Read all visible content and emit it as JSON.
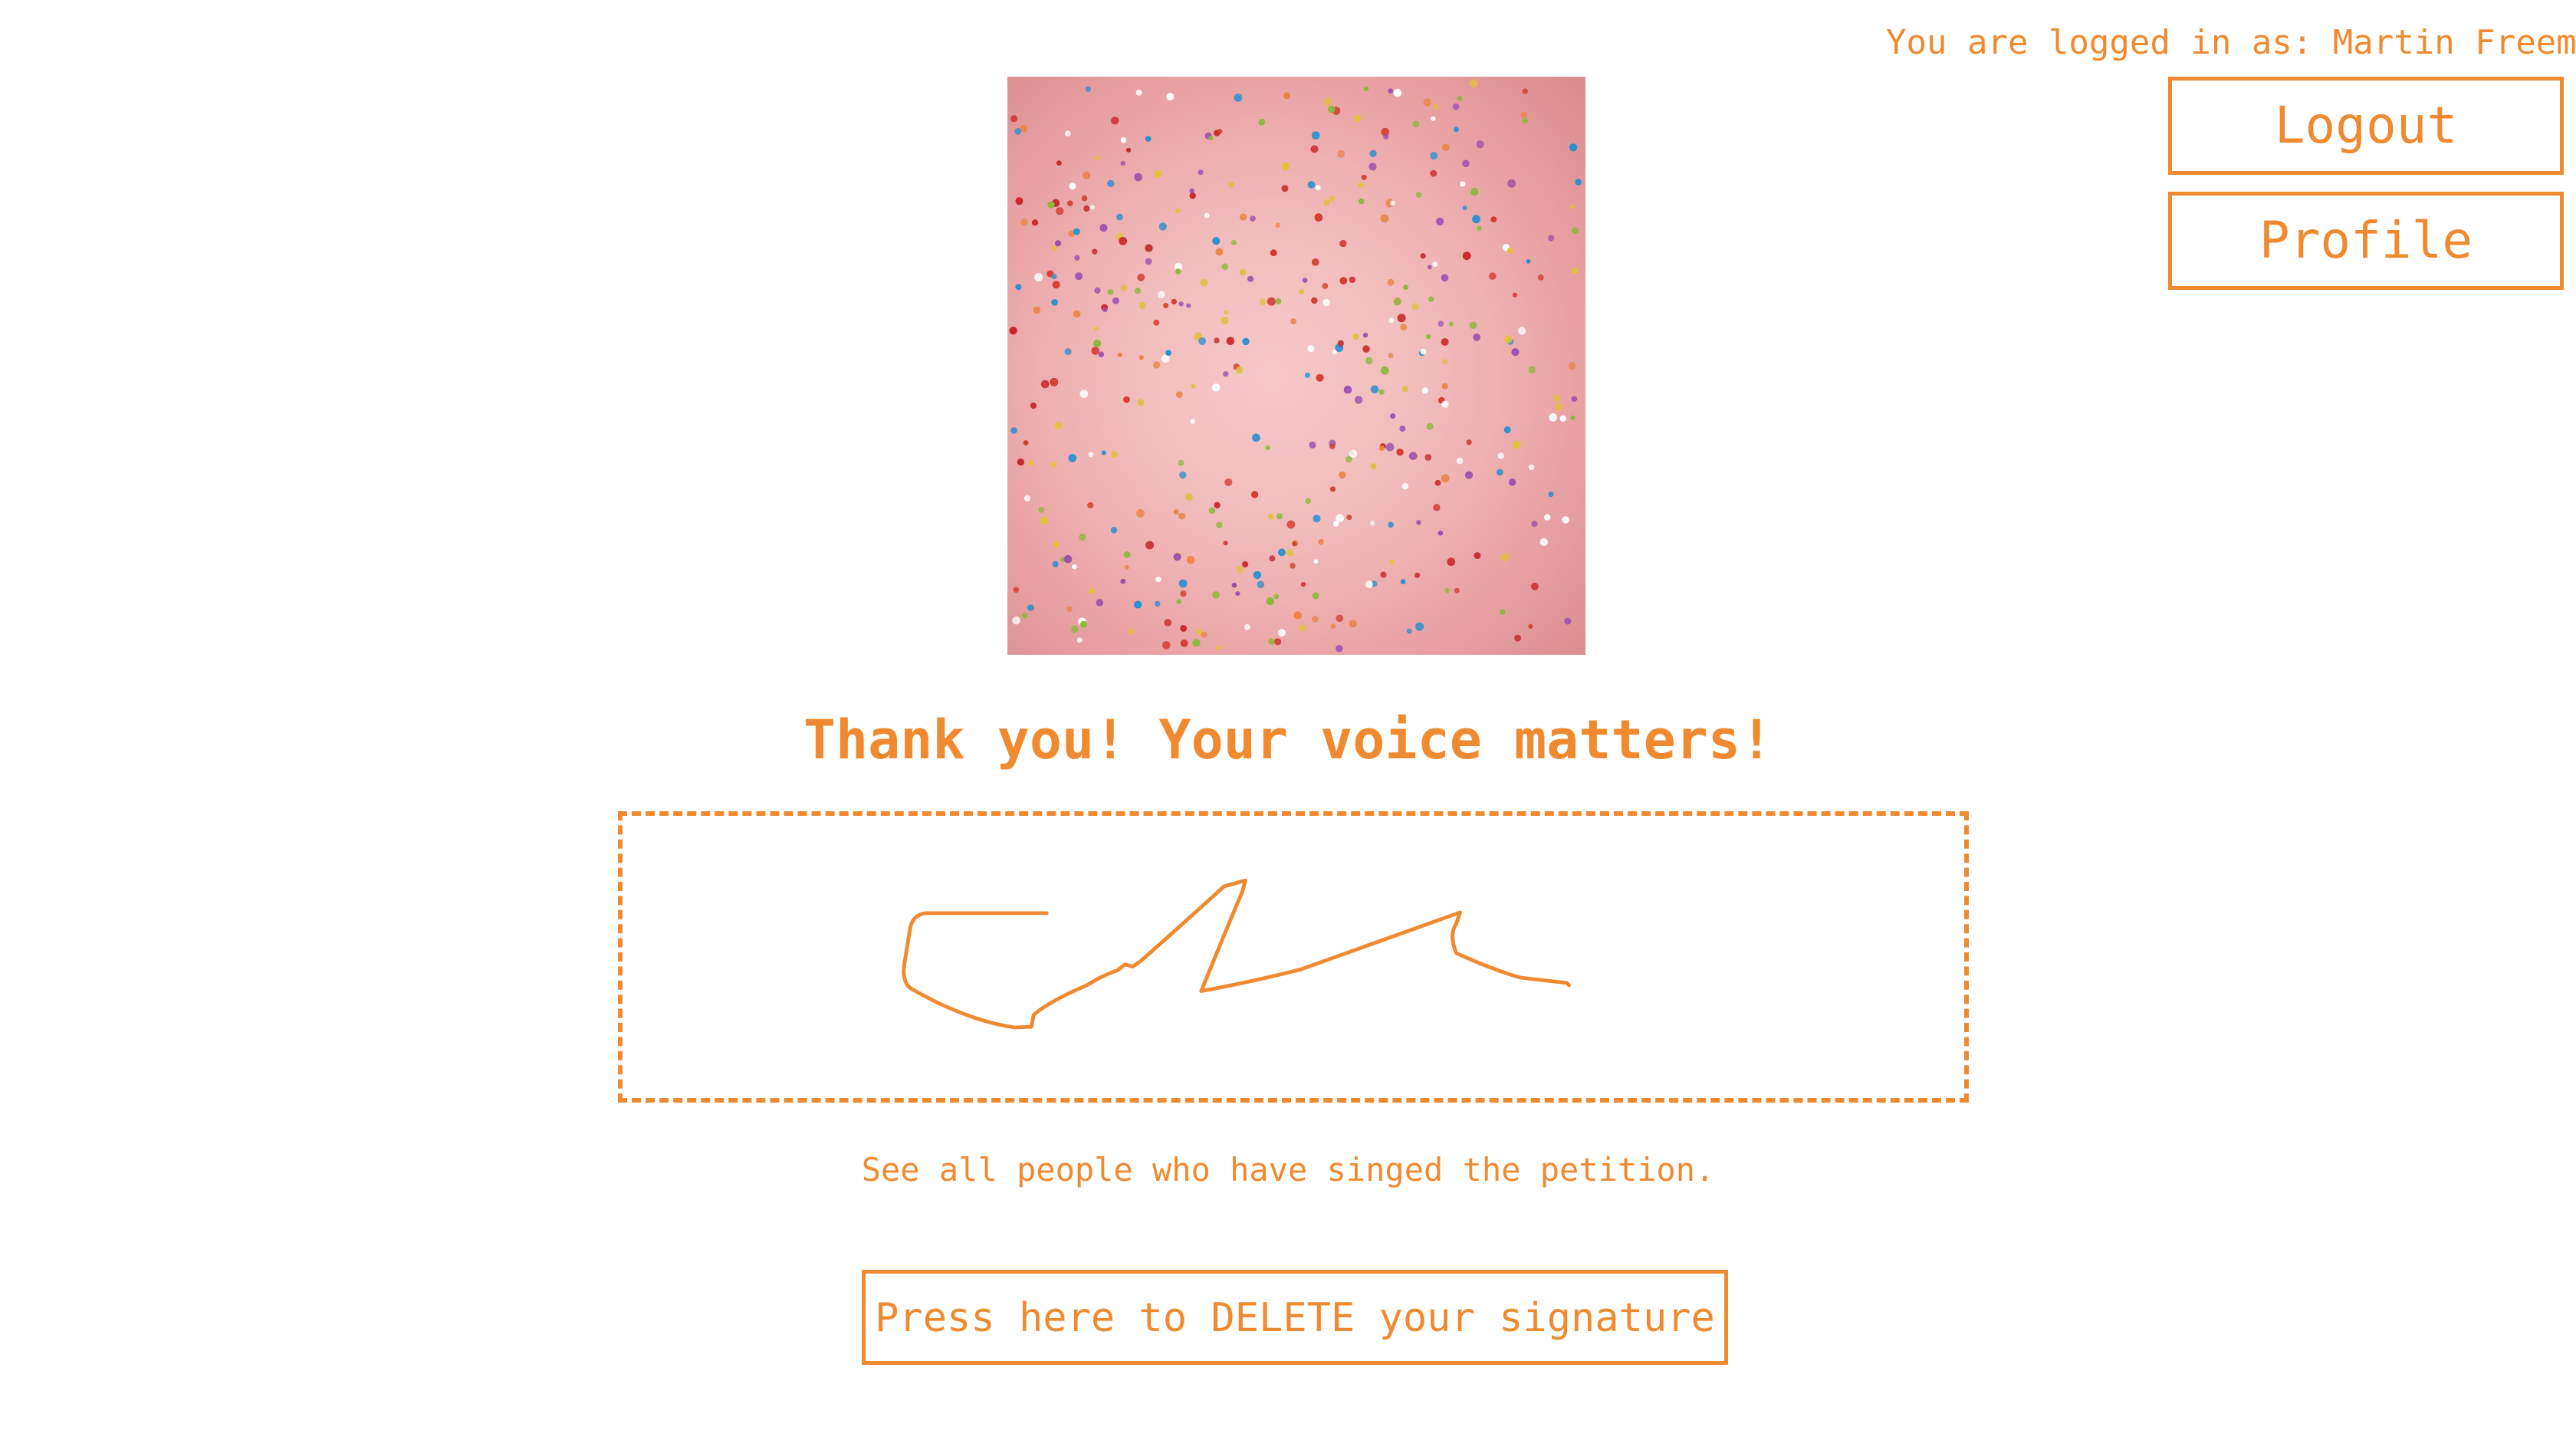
{
  "header": {
    "login_status": "You are logged in as: Martin Freeman",
    "logout_label": "Logout",
    "profile_label": "Profile"
  },
  "main": {
    "thank_you": "Thank you! Your voice matters!",
    "signers_link": "See all people who have singed the petition.",
    "delete_label": "Press here to DELETE your signature"
  },
  "colors": {
    "accent": "#f08a30",
    "background": "#ffffff",
    "donut_glaze": "#f2bcbc"
  }
}
